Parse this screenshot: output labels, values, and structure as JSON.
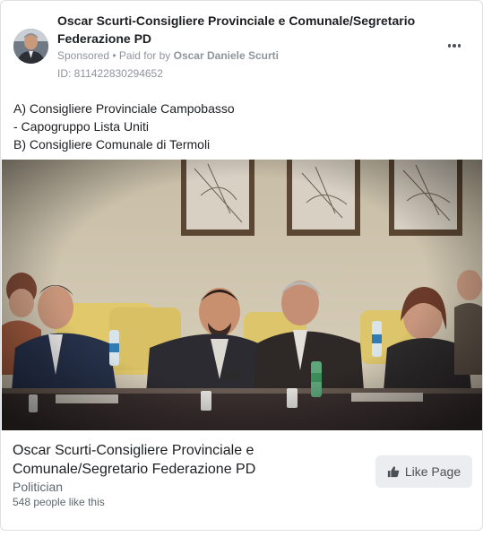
{
  "post": {
    "page_name": "Oscar Scurti-Consigliere Provinciale e Comunale/Segretario Federazione PD",
    "sponsored_label": "Sponsored",
    "separator": " • ",
    "paid_for_prefix": "Paid for by ",
    "paid_for_name": "Oscar Daniele Scurti",
    "ad_id": "ID: 811422830294652",
    "more_icon": "more-horizontal-icon",
    "body_lines": [
      "A) Consigliere Provinciale Campobasso",
      "- Capogruppo Lista Uniti",
      "B) Consigliere Comunale di Termoli"
    ]
  },
  "footer": {
    "title": "Oscar Scurti-Consigliere Provinciale e Comunale/Segretario Federazione PD",
    "category": "Politician",
    "likes": "548 people like this",
    "like_button_label": "Like Page",
    "like_icon": "thumbs-up-icon"
  },
  "colors": {
    "text_primary": "#1c1e21",
    "text_secondary": "#90949c",
    "button_bg": "#ebedf0",
    "border": "#dddfe2"
  }
}
